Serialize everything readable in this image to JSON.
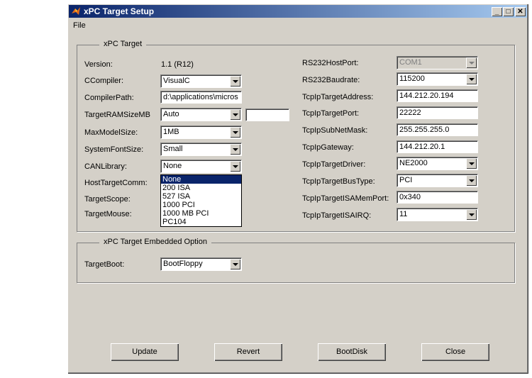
{
  "window": {
    "title": "xPC Target Setup"
  },
  "menu": {
    "file": "File"
  },
  "panel_main": {
    "title": "xPC Target",
    "left": {
      "version_label": "Version:",
      "version_value": "1.1 (R12)",
      "ccompiler_label": "CCompiler:",
      "ccompiler_value": "VisualC",
      "compilerpath_label": "CompilerPath:",
      "compilerpath_value": "d:\\applications\\micros",
      "targetram_label": "TargetRAMSizeMB",
      "targetram_value": "Auto",
      "targetram_extra": "",
      "maxmodel_label": "MaxModelSize:",
      "maxmodel_value": "1MB",
      "fontsize_label": "SystemFontSize:",
      "fontsize_value": "Small",
      "canlib_label": "CANLibrary:",
      "canlib_value": "None",
      "hostcomm_label": "HostTargetComm:",
      "scope_label": "TargetScope:",
      "mouse_label": "TargetMouse:"
    },
    "right": {
      "rs232port_label": "RS232HostPort:",
      "rs232port_value": "COM1",
      "rs232baud_label": "RS232Baudrate:",
      "rs232baud_value": "115200",
      "ipaddr_label": "TcpIpTargetAddress:",
      "ipaddr_value": "144.212.20.194",
      "ipport_label": "TcpIpTargetPort:",
      "ipport_value": "22222",
      "subnet_label": "TcpIpSubNetMask:",
      "subnet_value": "255.255.255.0",
      "gateway_label": "TcpIpGateway:",
      "gateway_value": "144.212.20.1",
      "driver_label": "TcpIpTargetDriver:",
      "driver_value": "NE2000",
      "bustype_label": "TcpIpTargetBusType:",
      "bustype_value": "PCI",
      "isamem_label": "TcpIpTargetISAMemPort:",
      "isamem_value": "0x340",
      "isairq_label": "TcpIpTargetISAIRQ:",
      "isairq_value": "11"
    }
  },
  "canlib_dropdown": {
    "options": [
      "None",
      "200 ISA",
      "527 ISA",
      "1000 PCI",
      "1000 MB PCI",
      "PC104"
    ],
    "selected": "None"
  },
  "panel_embedded": {
    "title": "xPC Target Embedded Option",
    "targetboot_label": "TargetBoot:",
    "targetboot_value": "BootFloppy"
  },
  "buttons": {
    "update": "Update",
    "revert": "Revert",
    "bootdisk": "BootDisk",
    "close": "Close"
  },
  "colors": {
    "titlebar": "#0a246a",
    "face": "#d4d0c8",
    "selection": "#0a246a"
  }
}
